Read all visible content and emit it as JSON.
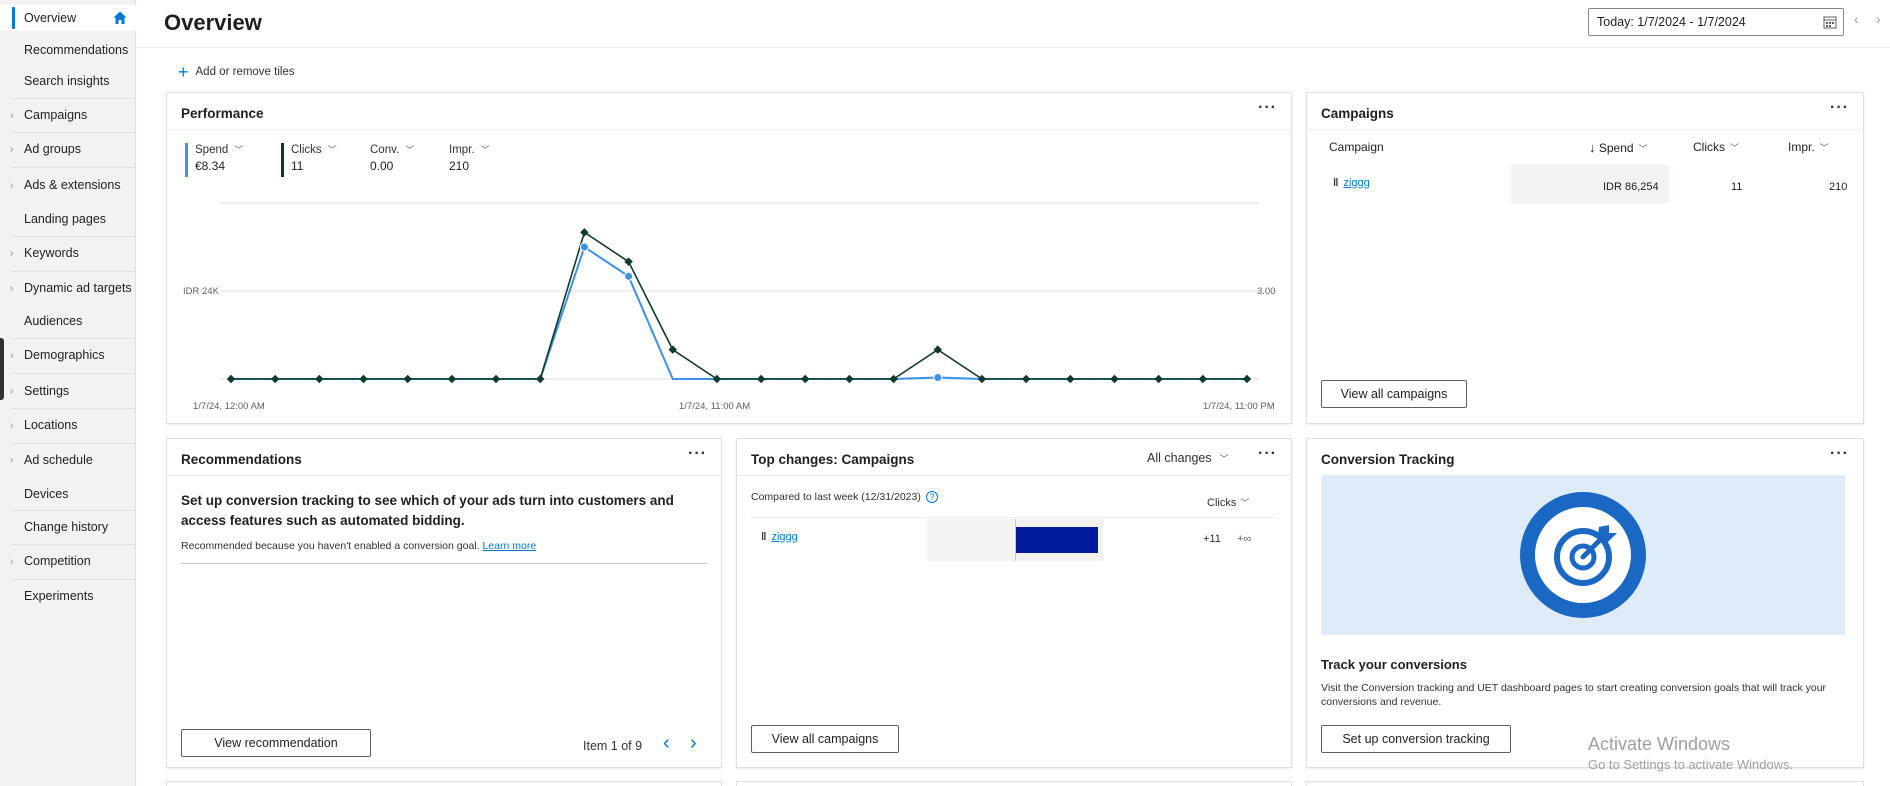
{
  "sidebar": {
    "items": [
      {
        "label": "Overview"
      },
      {
        "label": "Recommendations"
      },
      {
        "label": "Search insights"
      },
      {
        "label": "Campaigns"
      },
      {
        "label": "Ad groups"
      },
      {
        "label": "Ads & extensions"
      },
      {
        "label": "Landing pages"
      },
      {
        "label": "Keywords"
      },
      {
        "label": "Dynamic ad targets"
      },
      {
        "label": "Audiences"
      },
      {
        "label": "Demographics"
      },
      {
        "label": "Settings"
      },
      {
        "label": "Locations"
      },
      {
        "label": "Ad schedule"
      },
      {
        "label": "Devices"
      },
      {
        "label": "Change history"
      },
      {
        "label": "Competition"
      },
      {
        "label": "Experiments"
      }
    ]
  },
  "header": {
    "title": "Overview",
    "date_range": "Today: 1/7/2024 - 1/7/2024",
    "add_tiles": "Add or remove tiles"
  },
  "performance": {
    "title": "Performance",
    "metrics": [
      {
        "name": "Spend",
        "value": "€8.34",
        "color": "#3c91e6"
      },
      {
        "name": "Clicks",
        "value": "11",
        "color": "#0f3b2e"
      },
      {
        "name": "Conv.",
        "value": "0.00"
      },
      {
        "name": "Impr.",
        "value": "210"
      }
    ],
    "y_left_label": "IDR 24K",
    "y_right_label": "3.00",
    "x_labels": [
      "1/7/24, 12:00 AM",
      "1/7/24, 11:00 AM",
      "1/7/24, 11:00 PM"
    ]
  },
  "chart_data": {
    "type": "line",
    "x": [
      0,
      1,
      2,
      3,
      4,
      5,
      6,
      7,
      8,
      9,
      10,
      11,
      12,
      13,
      14,
      15,
      16,
      17,
      18,
      19,
      20,
      21,
      22,
      23
    ],
    "series": [
      {
        "name": "Spend",
        "color": "#3c91e6",
        "values": [
          0,
          0,
          0,
          0,
          0,
          0,
          0,
          0,
          36000,
          28000,
          0,
          0,
          0,
          0,
          0,
          0,
          400,
          0,
          0,
          0,
          0,
          0,
          0,
          0
        ]
      },
      {
        "name": "Clicks",
        "color": "#0f3b2e",
        "values": [
          0,
          0,
          0,
          0,
          0,
          0,
          0,
          0,
          5,
          4,
          1,
          0,
          0,
          0,
          0,
          0,
          1,
          0,
          0,
          0,
          0,
          0,
          0,
          0
        ]
      }
    ],
    "ylim_left": [
      0,
      48000
    ],
    "ylim_right": [
      0,
      6
    ],
    "grid": true
  },
  "campaigns": {
    "title": "Campaigns",
    "columns": [
      "Campaign",
      "Spend",
      "Clicks",
      "Impr."
    ],
    "rows": [
      {
        "name": "ziggg",
        "spend": "IDR 86,254",
        "clicks": "11",
        "impr": "210"
      }
    ],
    "view_all": "View all campaigns"
  },
  "recommendations": {
    "title": "Recommendations",
    "headline": "Set up conversion tracking to see which of your ads turn into customers and access features such as automated bidding.",
    "reason": "Recommended because you haven't enabled a conversion goal.",
    "learn_more": "Learn more",
    "button": "View recommendation",
    "pager": "Item 1 of 9"
  },
  "top_changes": {
    "title": "Top changes: Campaigns",
    "filter": "All changes",
    "compared": "Compared to last week (12/31/2023)",
    "metric": "Clicks",
    "rows": [
      {
        "name": "ziggg",
        "change": "+11",
        "pct": "+∞",
        "bar_fraction": 1.0
      }
    ],
    "button": "View all campaigns"
  },
  "conversion": {
    "title": "Conversion Tracking",
    "subtitle": "Track your conversions",
    "desc": "Visit the Conversion tracking and UET dashboard pages to start creating conversion goals that will track your conversions and revenue.",
    "button": "Set up conversion tracking",
    "accent": "#1b68c4",
    "panel_bg": "#deebf8"
  },
  "watermark": {
    "line1": "Activate Windows",
    "line2": "Go to Settings to activate Windows."
  }
}
